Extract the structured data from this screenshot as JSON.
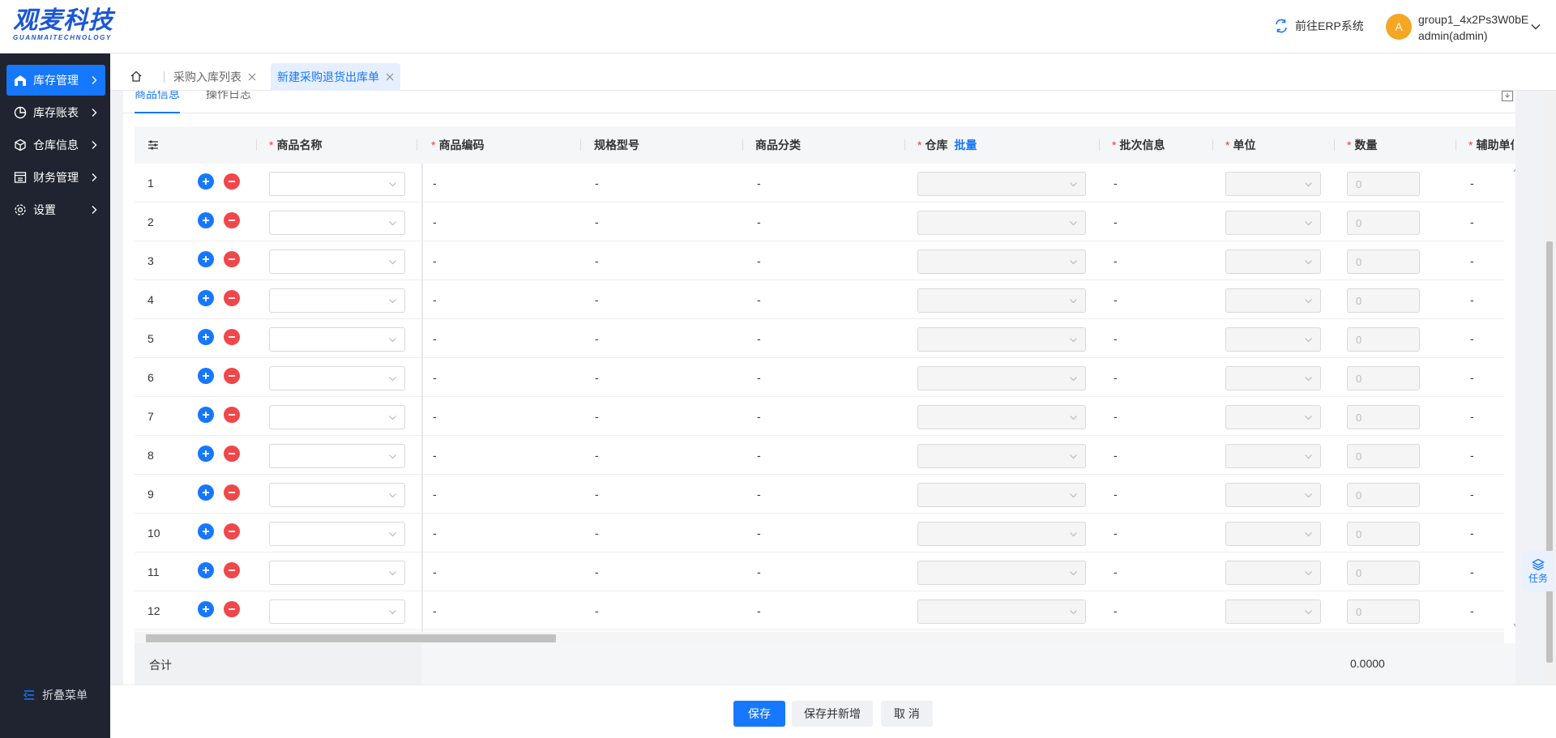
{
  "logo": {
    "main": "观麦科技",
    "sub": "GUANMAITECHNOLOGY"
  },
  "header": {
    "erp_link": "前往ERP系统",
    "avatar_letter": "A",
    "user_group": "group1_4x2Ps3W0bE",
    "user_name": "admin(admin)"
  },
  "sidebar": {
    "items": [
      {
        "label": "库存管理",
        "icon": "warehouse-icon",
        "active": true
      },
      {
        "label": "库存账表",
        "icon": "pie-chart-icon",
        "active": false
      },
      {
        "label": "仓库信息",
        "icon": "cube-icon",
        "active": false
      },
      {
        "label": "财务管理",
        "icon": "finance-icon",
        "active": false
      },
      {
        "label": "设置",
        "icon": "gear-icon",
        "active": false
      }
    ],
    "collapse_label": "折叠菜单"
  },
  "tabs": [
    {
      "label": "采购入库列表",
      "active": false
    },
    {
      "label": "新建采购退货出库单",
      "active": true
    }
  ],
  "subtabs": [
    {
      "label": "商品信息",
      "active": true
    },
    {
      "label": "操作日志",
      "active": false
    }
  ],
  "table": {
    "columns": {
      "name": "商品名称",
      "code": "商品编码",
      "spec": "规格型号",
      "category": "商品分类",
      "warehouse": "仓库",
      "warehouse_bulk": "批量",
      "batch": "批次信息",
      "unit": "单位",
      "qty": "数量",
      "aux_unit": "辅助单位"
    },
    "required_mark": "*",
    "placeholder_dash": "-",
    "qty_placeholder": "0",
    "rows": [
      {
        "index": "1"
      },
      {
        "index": "2"
      },
      {
        "index": "3"
      },
      {
        "index": "4"
      },
      {
        "index": "5"
      },
      {
        "index": "6"
      },
      {
        "index": "7"
      },
      {
        "index": "8"
      },
      {
        "index": "9"
      },
      {
        "index": "10"
      },
      {
        "index": "11"
      },
      {
        "index": "12"
      }
    ],
    "totals_label": "合计",
    "totals_qty": "0.0000"
  },
  "actions": {
    "save": "保存",
    "save_new": "保存并新增",
    "cancel": "取 消"
  },
  "task_float": "任务",
  "colors": {
    "primary": "#1677ff",
    "danger": "#f0474a",
    "sidebar_bg": "#1f2430",
    "avatar": "#f5a623"
  }
}
